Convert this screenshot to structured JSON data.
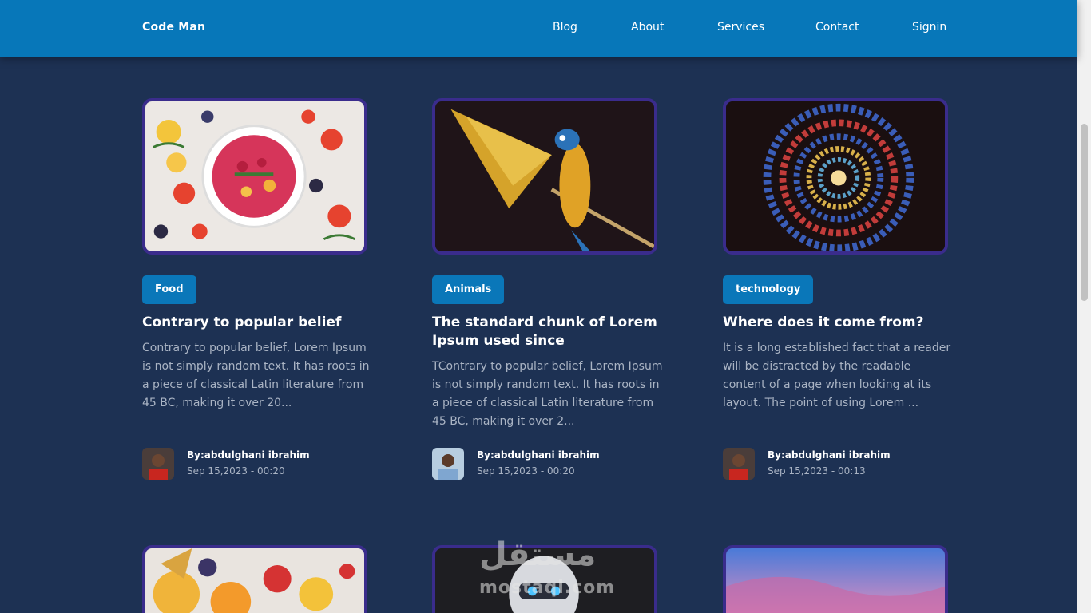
{
  "nav": {
    "brand": "Code Man",
    "links": [
      "Blog",
      "About",
      "Services",
      "Contact",
      "Signin"
    ]
  },
  "posts": [
    {
      "tag": "Food",
      "title": "Contrary to popular belief",
      "excerpt": "Contrary to popular belief, Lorem Ipsum is not simply random text. It has roots in a piece of classical Latin literature from 45 BC, making it over 20...",
      "author": "By:abdulghani ibrahim",
      "date": "Sep 15,2023 - 00:20",
      "image_icon": "fruit-bowl-image"
    },
    {
      "tag": "Animals",
      "title": "The standard chunk of Lorem Ipsum used since",
      "excerpt": "TContrary to popular belief, Lorem Ipsum is not simply random text. It has roots in a piece of classical Latin literature from 45 BC, making it over 2...",
      "author": "By:abdulghani ibrahim",
      "date": "Sep 15,2023 - 00:20",
      "image_icon": "parrot-image"
    },
    {
      "tag": "technology",
      "title": "Where does it come from?",
      "excerpt": "It is a long established fact that a reader will be distracted by the readable content of a page when looking at its layout. The point of using Lorem ...",
      "author": "By:abdulghani ibrahim",
      "date": "Sep 15,2023 - 00:13",
      "image_icon": "stained-glass-spiral-image"
    }
  ],
  "watermark": {
    "arabic": "مستقل",
    "latin": "mostaql.com"
  },
  "colors": {
    "navbar": "#0777b9",
    "background": "#1d3153",
    "tag": "#0a77b9",
    "image_border": "#3a2c8c"
  }
}
